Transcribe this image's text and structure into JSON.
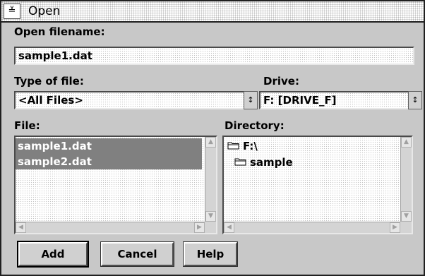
{
  "window": {
    "title": "Open",
    "system_menu_glyph": "≚"
  },
  "open_filename": {
    "label": "Open filename:",
    "value": "sample1.dat"
  },
  "type_of_file": {
    "label": "Type of file:",
    "value": "<All Files>"
  },
  "drive": {
    "label": "Drive:",
    "value": "F:  [DRIVE_F]"
  },
  "file_list": {
    "label": "File:",
    "items": [
      "sample1.dat",
      "sample2.dat"
    ]
  },
  "directory": {
    "label": "Directory:",
    "items": [
      "F:\\",
      "sample"
    ]
  },
  "buttons": {
    "add": "Add",
    "cancel": "Cancel",
    "help": "Help"
  },
  "icons": {
    "system_menu": "system-menu-icon",
    "dropdown": "dropdown-arrow-icon",
    "folder": "folder-icon",
    "scroll_up": "scroll-up-icon",
    "scroll_down": "scroll-down-icon",
    "scroll_left": "scroll-left-icon",
    "scroll_right": "scroll-right-icon"
  },
  "colors": {
    "selection": "#808080",
    "window_bg": "#c8c8c8"
  }
}
